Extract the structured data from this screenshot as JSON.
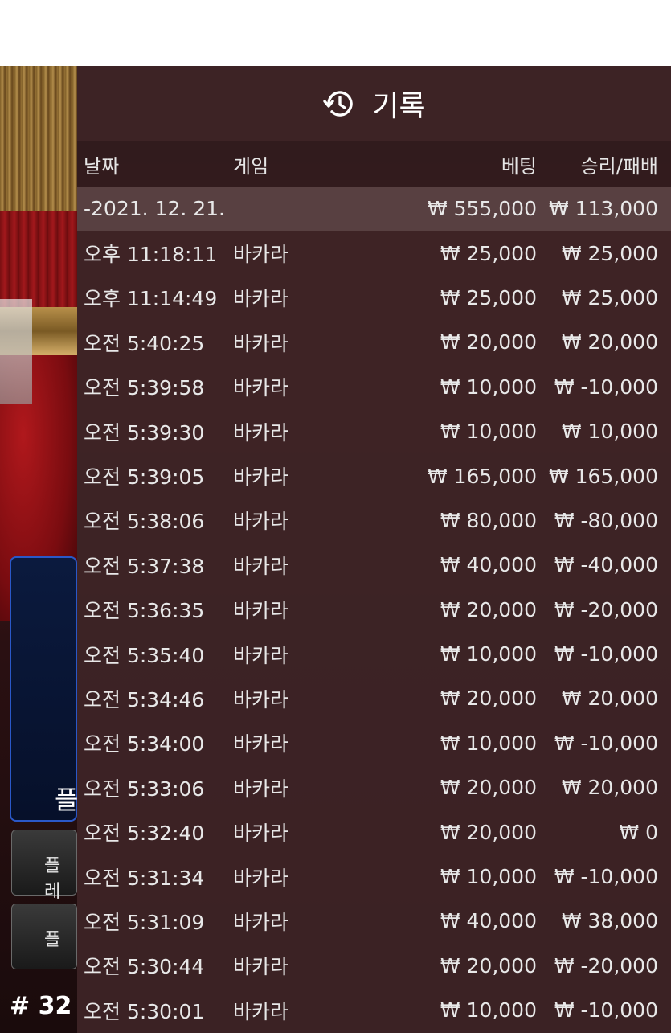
{
  "background": {
    "panel_text": "플",
    "button1_text": "플레",
    "button2_text": "플",
    "table_number": "# 32"
  },
  "history": {
    "icon": "history-icon",
    "title": "기록",
    "columns": {
      "date": "날짜",
      "game": "게임",
      "bet": "베팅",
      "result": "승리/패배"
    },
    "date_group": {
      "date": "-2021. 12. 21.",
      "bet_total": "₩ 555,000",
      "result_total": "₩ 113,000"
    },
    "rows": [
      {
        "time": "오후 11:18:11",
        "game": "바카라",
        "bet": "₩ 25,000",
        "result": "₩ 25,000"
      },
      {
        "time": "오후 11:14:49",
        "game": "바카라",
        "bet": "₩ 25,000",
        "result": "₩ 25,000"
      },
      {
        "time": "오전 5:40:25",
        "game": "바카라",
        "bet": "₩ 20,000",
        "result": "₩ 20,000"
      },
      {
        "time": "오전 5:39:58",
        "game": "바카라",
        "bet": "₩ 10,000",
        "result": "₩ -10,000"
      },
      {
        "time": "오전 5:39:30",
        "game": "바카라",
        "bet": "₩ 10,000",
        "result": "₩ 10,000"
      },
      {
        "time": "오전 5:39:05",
        "game": "바카라",
        "bet": "₩ 165,000",
        "result": "₩ 165,000"
      },
      {
        "time": "오전 5:38:06",
        "game": "바카라",
        "bet": "₩ 80,000",
        "result": "₩ -80,000"
      },
      {
        "time": "오전 5:37:38",
        "game": "바카라",
        "bet": "₩ 40,000",
        "result": "₩ -40,000"
      },
      {
        "time": "오전 5:36:35",
        "game": "바카라",
        "bet": "₩ 20,000",
        "result": "₩ -20,000"
      },
      {
        "time": "오전 5:35:40",
        "game": "바카라",
        "bet": "₩ 10,000",
        "result": "₩ -10,000"
      },
      {
        "time": "오전 5:34:46",
        "game": "바카라",
        "bet": "₩ 20,000",
        "result": "₩ 20,000"
      },
      {
        "time": "오전 5:34:00",
        "game": "바카라",
        "bet": "₩ 10,000",
        "result": "₩ -10,000"
      },
      {
        "time": "오전 5:33:06",
        "game": "바카라",
        "bet": "₩ 20,000",
        "result": "₩ 20,000"
      },
      {
        "time": "오전 5:32:40",
        "game": "바카라",
        "bet": "₩ 20,000",
        "result": "₩ 0"
      },
      {
        "time": "오전 5:31:34",
        "game": "바카라",
        "bet": "₩ 10,000",
        "result": "₩ -10,000"
      },
      {
        "time": "오전 5:31:09",
        "game": "바카라",
        "bet": "₩ 40,000",
        "result": "₩ 38,000"
      },
      {
        "time": "오전 5:30:44",
        "game": "바카라",
        "bet": "₩ 20,000",
        "result": "₩ -20,000"
      },
      {
        "time": "오전 5:30:01",
        "game": "바카라",
        "bet": "₩ 10,000",
        "result": "₩ -10,000"
      }
    ]
  }
}
